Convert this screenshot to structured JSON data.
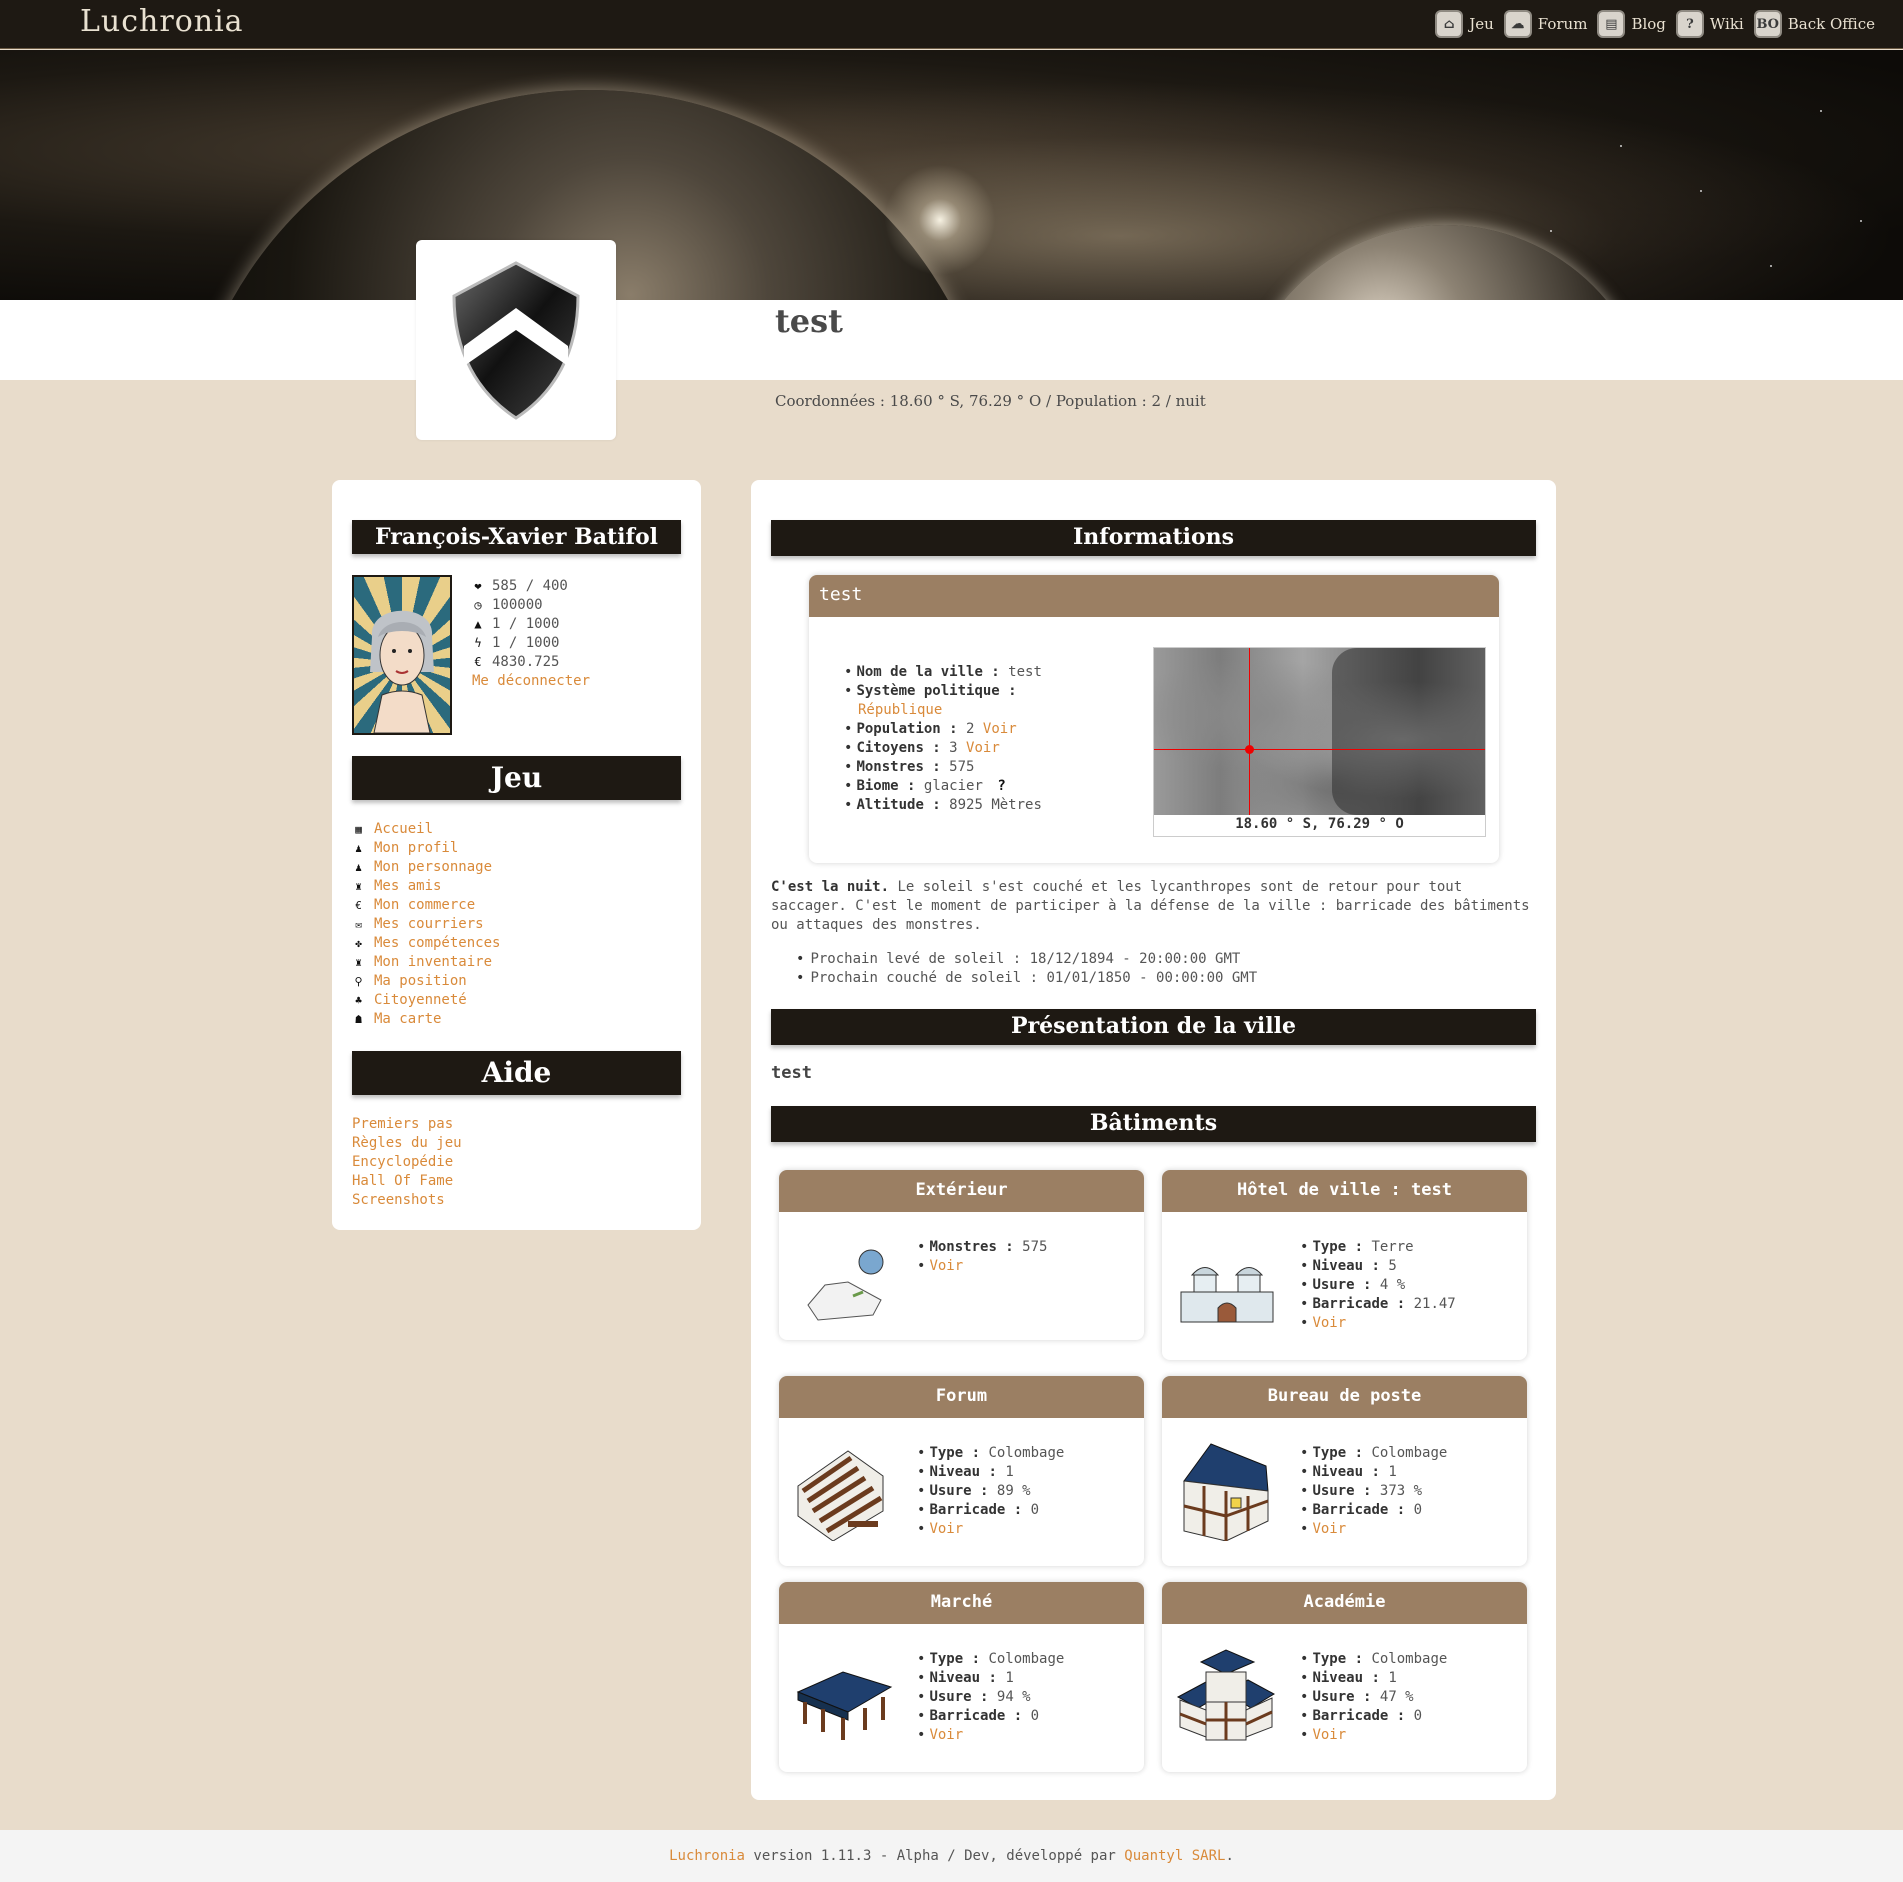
{
  "brand": "Luchronia",
  "topnav": [
    {
      "label": "Jeu",
      "icon": "home-icon",
      "glyph": "⌂"
    },
    {
      "label": "Forum",
      "icon": "forum-icon",
      "glyph": "☁"
    },
    {
      "label": "Blog",
      "icon": "blog-icon",
      "glyph": "▤"
    },
    {
      "label": "Wiki",
      "icon": "wiki-icon",
      "glyph": "?"
    },
    {
      "label": "Back Office",
      "icon": "back-office-icon",
      "glyph": "BO"
    }
  ],
  "city": {
    "name": "test",
    "coords_line": "Coordonnées : 18.60 ° S, 76.29 ° O / Population : 2 / nuit"
  },
  "character": {
    "name": "François-Xavier Batifol",
    "stats": [
      {
        "icon": "heart-icon",
        "glyph": "❤",
        "value": "585 / 400"
      },
      {
        "icon": "clock-icon",
        "glyph": "◷",
        "value": "100000"
      },
      {
        "icon": "water-drop-icon",
        "glyph": "▲",
        "value": "1 / 1000"
      },
      {
        "icon": "lightning-icon",
        "glyph": "ϟ",
        "value": "1 / 1000"
      },
      {
        "icon": "euro-icon",
        "glyph": "€",
        "value": "4830.725"
      }
    ],
    "logout": "Me déconnecter"
  },
  "jeu_menu": {
    "title": "Jeu",
    "items": [
      {
        "label": "Accueil",
        "icon": "calendar-icon",
        "glyph": "▦"
      },
      {
        "label": "Mon profil",
        "icon": "user-icon",
        "glyph": "♟"
      },
      {
        "label": "Mon personnage",
        "icon": "character-icon",
        "glyph": "♟"
      },
      {
        "label": "Mes amis",
        "icon": "friends-icon",
        "glyph": "♜"
      },
      {
        "label": "Mon commerce",
        "icon": "euro-icon",
        "glyph": "€"
      },
      {
        "label": "Mes courriers",
        "icon": "mail-icon",
        "glyph": "✉"
      },
      {
        "label": "Mes compétences",
        "icon": "skills-icon",
        "glyph": "✤"
      },
      {
        "label": "Mon inventaire",
        "icon": "inventory-icon",
        "glyph": "♜"
      },
      {
        "label": "Ma position",
        "icon": "location-pin-icon",
        "glyph": "⚲"
      },
      {
        "label": "Citoyenneté",
        "icon": "citizenship-icon",
        "glyph": "♣"
      },
      {
        "label": "Ma carte",
        "icon": "map-icon",
        "glyph": "☗"
      }
    ]
  },
  "aide_menu": {
    "title": "Aide",
    "items": [
      "Premiers pas",
      "Règles du jeu",
      "Encyclopédie",
      "Hall Of Fame",
      "Screenshots"
    ]
  },
  "informations": {
    "section_title": "Informations",
    "card_title": "test",
    "nom_label": "Nom de la ville :",
    "nom_value": "test",
    "systeme_label": "Système politique :",
    "systeme_value": "République",
    "population_label": "Population :",
    "population_value": "2",
    "citoyens_label": "Citoyens :",
    "citoyens_value": "3",
    "monstres_label": "Monstres :",
    "monstres_value": "575",
    "biome_label": "Biome :",
    "biome_value": "glacier",
    "biome_help": "?",
    "altitude_label": "Altitude :",
    "altitude_value": "8925 Mètres",
    "voir": "Voir",
    "map_caption": "18.60 ° S, 76.29 ° O",
    "night_bold": "C'est la nuit.",
    "night_text": " Le soleil s'est couché et les lycanthropes sont de retour pour tout saccager. C'est le moment de participer à la défense de la ville : barricade des bâtiments ou attaques des monstres.",
    "sunrise": "Prochain levé de soleil : 18/12/1894 - 20:00:00 GMT",
    "sunset": "Prochain couché de soleil : 01/01/1850 - 00:00:00 GMT"
  },
  "presentation": {
    "title": "Présentation de la ville",
    "text": "test"
  },
  "batiments": {
    "title": "Bâtiments",
    "labels": {
      "type": "Type :",
      "niveau": "Niveau :",
      "usure": "Usure :",
      "barricade": "Barricade :",
      "monstres": "Monstres :",
      "voir": "Voir"
    },
    "exterieur": {
      "title": "Extérieur",
      "monstres": "575"
    },
    "hotel": {
      "title": "Hôtel de ville : test",
      "type": "Terre",
      "niveau": "5",
      "usure": "4 %",
      "barricade": "21.47"
    },
    "forum": {
      "title": "Forum",
      "type": "Colombage",
      "niveau": "1",
      "usure": "89 %",
      "barricade": "0"
    },
    "poste": {
      "title": "Bureau de poste",
      "type": "Colombage",
      "niveau": "1",
      "usure": "373 %",
      "barricade": "0"
    },
    "marche": {
      "title": "Marché",
      "type": "Colombage",
      "niveau": "1",
      "usure": "94 %",
      "barricade": "0"
    },
    "academie": {
      "title": "Académie",
      "type": "Colombage",
      "niveau": "1",
      "usure": "47 %",
      "barricade": "0"
    }
  },
  "footer": {
    "brand": "Luchronia",
    "text": " version 1.11.3 - Alpha / Dev, développé par ",
    "company": "Quantyl SARL",
    "end": "."
  },
  "colors": {
    "dark": "#1e1913",
    "accent": "#d98a3a",
    "card_header": "#9b7f63",
    "background": "#e8dccb"
  }
}
